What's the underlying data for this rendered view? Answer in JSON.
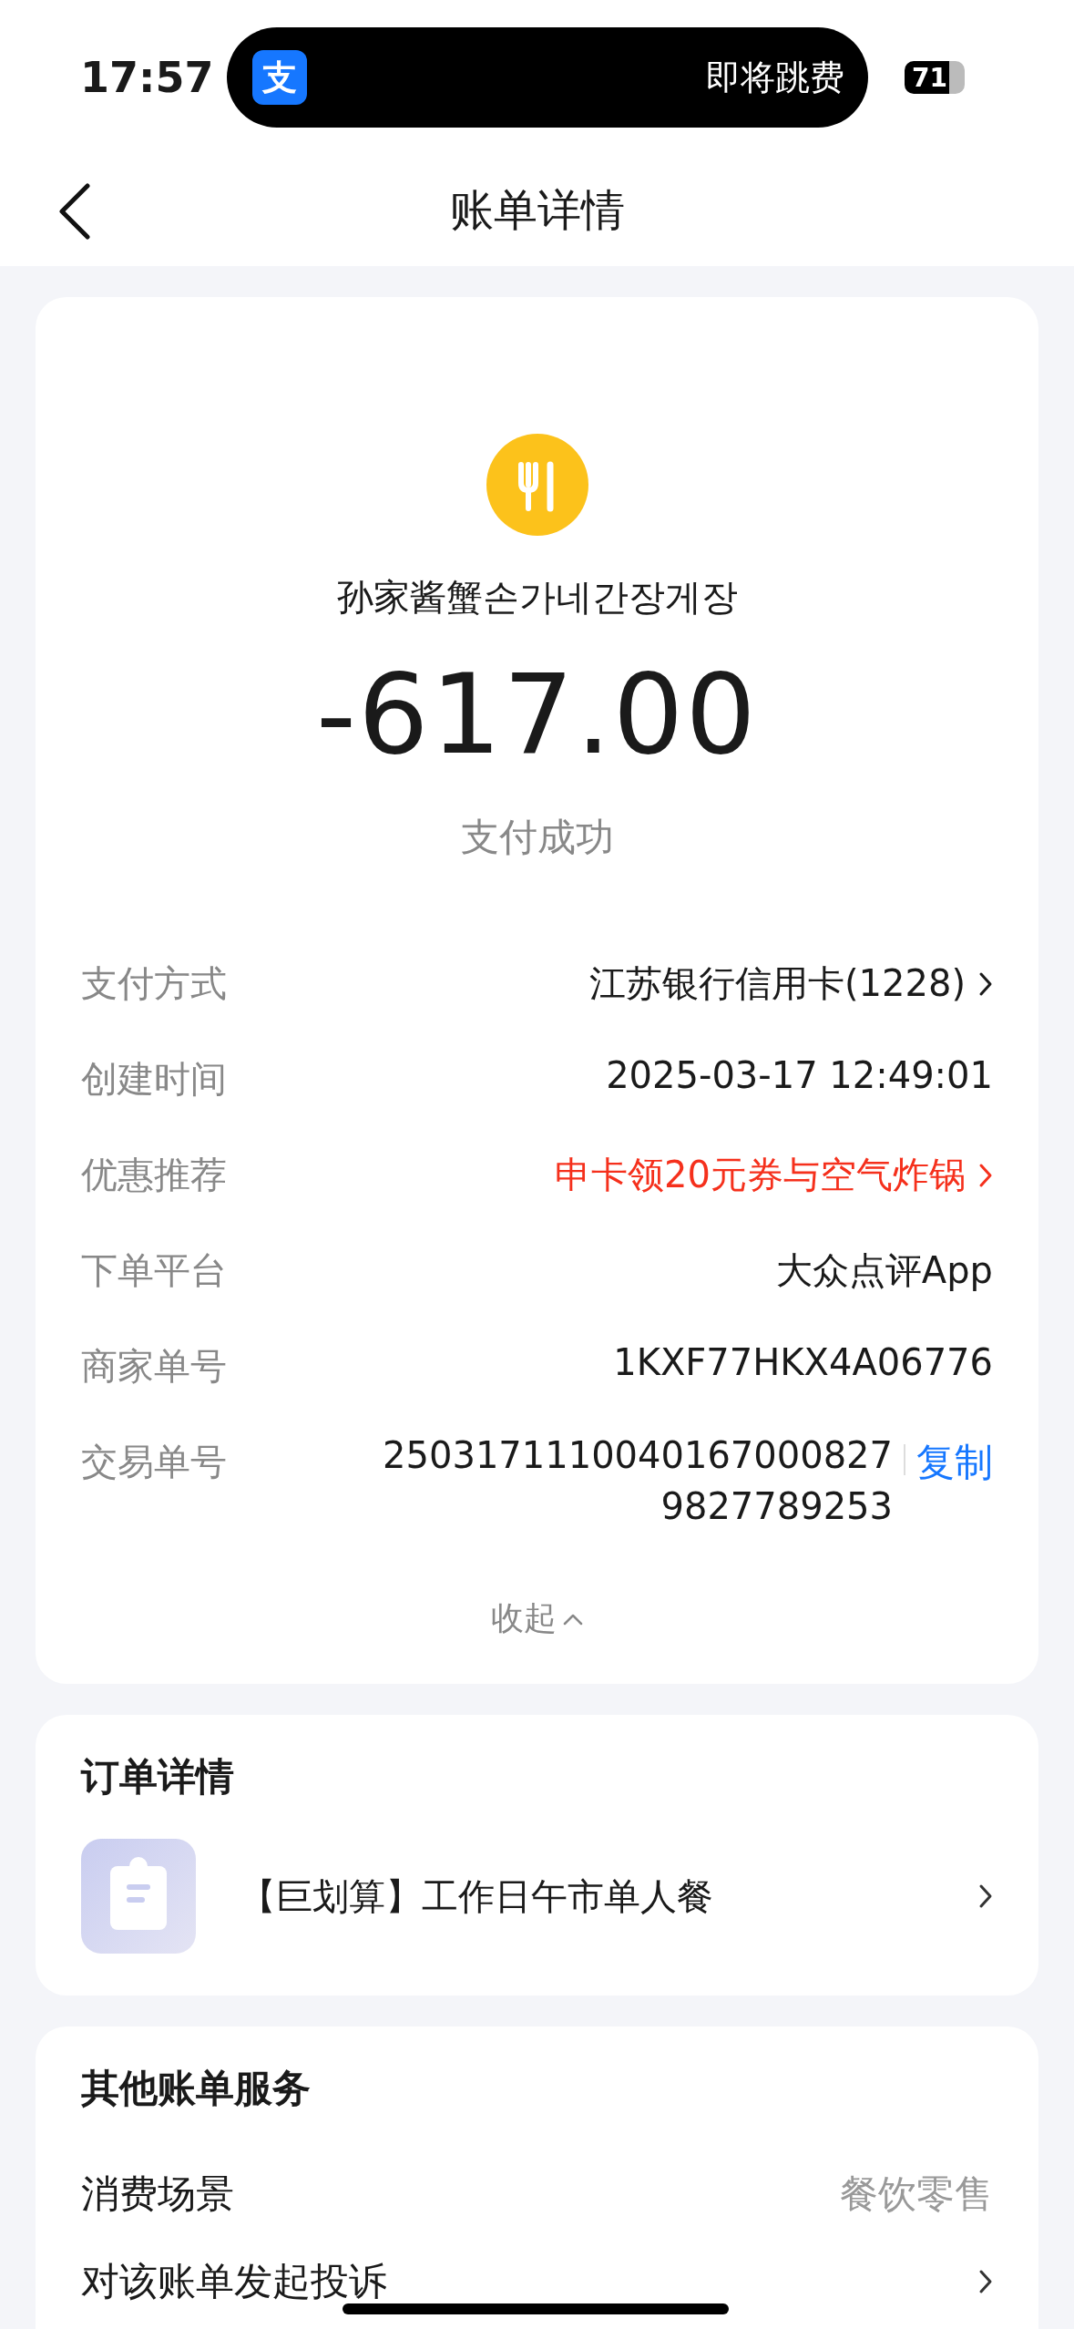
{
  "status_bar": {
    "time": "17:57",
    "island_app_glyph": "支",
    "island_text": "即将跳费",
    "battery": "71"
  },
  "nav": {
    "title": "账单详情"
  },
  "bill": {
    "merchant": "孙家酱蟹손가네간장게장",
    "amount": "-617.00",
    "status": "支付成功",
    "rows": [
      {
        "label": "支付方式",
        "value": "江苏银行信用卡(1228)",
        "kind": "link"
      },
      {
        "label": "创建时间",
        "value": "2025-03-17 12:49:01",
        "kind": "plain"
      },
      {
        "label": "优惠推荐",
        "value": "申卡领20元券与空气炸锅",
        "kind": "promo"
      },
      {
        "label": "下单平台",
        "value": "大众点评App",
        "kind": "plain"
      },
      {
        "label": "商家单号",
        "value": "1KXF77HKX4A06776",
        "kind": "plain"
      },
      {
        "label": "交易单号",
        "value": "25031711100401670008279827789253",
        "kind": "copy",
        "action": "复制"
      }
    ],
    "collapse": "收起"
  },
  "order": {
    "title": "订单详情",
    "item": "【巨划算】工作日午市单人餐"
  },
  "services": {
    "title": "其他账单服务",
    "rows": [
      {
        "label": "消费场景",
        "value": "餐饮零售"
      },
      {
        "label": "对该账单发起投诉"
      }
    ]
  }
}
